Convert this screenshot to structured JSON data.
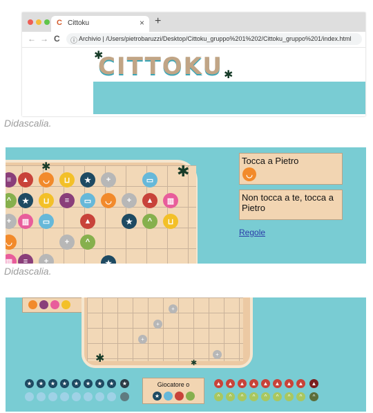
{
  "browser": {
    "tab_title": "Cittoku",
    "tab_favicon": "C",
    "close_glyph": "×",
    "new_tab_glyph": "+",
    "back_glyph": "←",
    "forward_glyph": "→",
    "reload_glyph": "C",
    "info_glyph": "ⓘ",
    "url": "Archivio  |  /Users/pietrobaruzzi/Desktop/Cittoku_gruppo%201%202/Cittoku_gruppo%201/index.html"
  },
  "logo": {
    "text": "CITTOKU"
  },
  "captions": [
    "Didascalia.",
    "Didascalia."
  ],
  "panel2": {
    "card1_text": "Tocca a Pietro",
    "card2_text": "Non tocca a te, tocca a Pietro",
    "rules_link": "Regole"
  },
  "panel3": {
    "player_label": "Giocatore o"
  },
  "colors": {
    "sea": "#79ccd3",
    "sand": "#ecc9a3",
    "card": "#f2d5b2",
    "orange": "#f28a2b",
    "purple": "#8a3f7a",
    "red": "#c8433a",
    "navy": "#1e4a62",
    "yellow": "#f3c028",
    "lightblue": "#66b8d9",
    "green": "#86b04d",
    "pink": "#e85d9b",
    "gray": "#b7b7b7"
  }
}
